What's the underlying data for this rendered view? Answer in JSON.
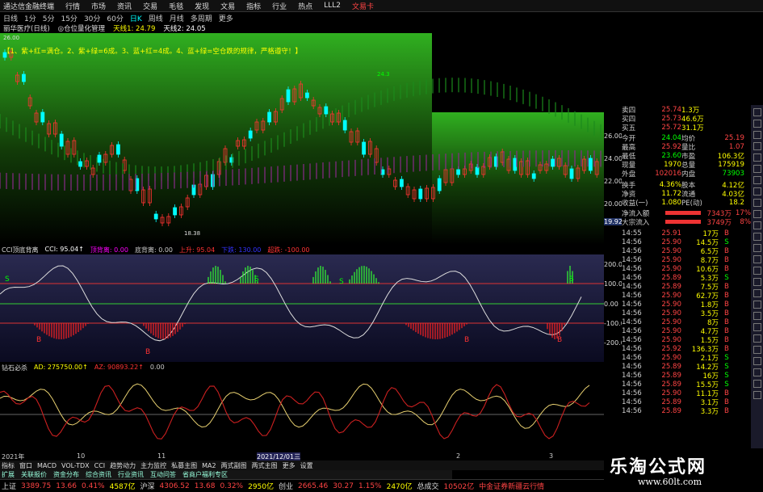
{
  "menubar": {
    "items": [
      "通达信金融终端",
      "行情",
      "市场",
      "资讯",
      "交易",
      "毛毯",
      "发现",
      "文易",
      "指标",
      "行业",
      "热点",
      "LLL2",
      "文易卡"
    ]
  },
  "periods": [
    "日线",
    "1分",
    "5分",
    "15分",
    "30分",
    "60分",
    "日K",
    "周线",
    "月线",
    "多周期",
    "更多"
  ],
  "period_selected": "日K",
  "info": {
    "stock": "丽华医疗(日线)",
    "indicator": "◎仓位量化管理",
    "line1": "天线1: 24.79",
    "line2": "天线2: 24.05"
  },
  "rule_text": "【1、紫+红=满仓。2、紫+绿=6成。3、蓝+红=4成。4、蓝+绿=空仓跌的规律，严格遵守！】",
  "main_chart": {
    "top_price": "26.00",
    "min_label": "18.38",
    "max_label": "24.3",
    "right_ticks": [
      "26.00",
      "24.00",
      "22.00",
      "20.00"
    ],
    "right_values": [
      "19.92"
    ]
  },
  "cci": {
    "title": "CCI顶底背离",
    "cci_value": "CCI: 95.04↑",
    "top_div": "顶背离: 0.00",
    "bottom_div": "底背离: 0.00",
    "up": "上升: 95.04",
    "down": "下跌: 130.00",
    "super": "超跌: -100.00",
    "ticks": [
      "200.00",
      "100.00",
      "0.00",
      "-100.00",
      "-200.00"
    ]
  },
  "ad": {
    "title": "钻石必杀",
    "ad_value": "AD: 275750.00↑",
    "az_value": "AZ: 90893.22↑",
    "zero": "0.00"
  },
  "time_axis": [
    "2021年",
    "10",
    "11",
    "2021/12/01三",
    "2",
    "3"
  ],
  "quote_panel": {
    "rows": [
      [
        "卖四",
        "25.74",
        "1.3万"
      ],
      [
        "买四",
        "25.73",
        "46.6万"
      ],
      [
        "买五",
        "25.72",
        "31.1万"
      ]
    ],
    "open_row": [
      "今开",
      "24.04",
      "均价",
      "25.19"
    ],
    "high_row": [
      "最高",
      "25.92",
      "量比",
      "1.07"
    ],
    "low_row": [
      "最低",
      "23.60",
      "市盈",
      "106.3亿"
    ],
    "vol_row": [
      "现量",
      "1970",
      "总量",
      "175919"
    ],
    "out_row": [
      "外盘",
      "102016",
      "内盘",
      "73903"
    ],
    "turn_row": [
      "换手",
      "4.36%",
      "股本",
      "4.12亿"
    ],
    "net_row": [
      "净资",
      "11.72",
      "流通",
      "4.03亿"
    ],
    "eps_row": [
      "收益(一)",
      "1.080",
      "PE(动)",
      "18.2"
    ],
    "inflow1": [
      "净流入额",
      "7343万",
      "17%"
    ],
    "inflow2": [
      "大宗流入",
      "3749万",
      "8%"
    ]
  },
  "ticks": [
    [
      "14:55",
      "25.91",
      "17万",
      "B"
    ],
    [
      "14:56",
      "25.90",
      "14.5万",
      "S"
    ],
    [
      "14:56",
      "25.90",
      "6.5万",
      "B"
    ],
    [
      "14:56",
      "25.90",
      "8.7万",
      "B"
    ],
    [
      "14:56",
      "25.90",
      "10.6万",
      "B"
    ],
    [
      "14:56",
      "25.89",
      "5.3万",
      "S"
    ],
    [
      "14:56",
      "25.89",
      "7.5万",
      "B"
    ],
    [
      "14:56",
      "25.90",
      "62.7万",
      "B"
    ],
    [
      "14:56",
      "25.90",
      "1.8万",
      "B"
    ],
    [
      "14:56",
      "25.90",
      "3.5万",
      "B"
    ],
    [
      "14:56",
      "25.90",
      "8万",
      "B"
    ],
    [
      "14:56",
      "25.90",
      "4.7万",
      "B"
    ],
    [
      "14:56",
      "25.90",
      "1.5万",
      "B"
    ],
    [
      "14:56",
      "25.92",
      "136.3万",
      "B"
    ],
    [
      "14:56",
      "25.90",
      "2.1万",
      "S"
    ],
    [
      "14:56",
      "25.89",
      "14.2万",
      "S"
    ],
    [
      "14:56",
      "25.89",
      "16万",
      "S"
    ],
    [
      "14:56",
      "25.89",
      "15.5万",
      "S"
    ],
    [
      "14:56",
      "25.90",
      "11.1万",
      "B"
    ],
    [
      "14:56",
      "25.89",
      "3.1万",
      "B"
    ],
    [
      "14:56",
      "25.89",
      "3.3万",
      "B"
    ]
  ],
  "tabs1": [
    "指标",
    "窗口",
    "MACD",
    "VOL-TDX",
    "CCI",
    "趋势动力",
    "主力监控",
    "私募主图",
    "MA2",
    "两式副图",
    "两式主图",
    "更多",
    "设置"
  ],
  "tabs2": [
    "扩展",
    "关联报价",
    "资金分布",
    "综合资讯",
    "行业资讯",
    "互动问答",
    "省商户福利专区"
  ],
  "ticker": [
    {
      "label": "上证",
      "v1": "3389.75",
      "v2": "13.66",
      "v3": "0.41%",
      "v4": "4587亿"
    },
    {
      "label": "沪深",
      "v1": "4306.52",
      "v2": "13.68",
      "v3": "0.32%",
      "v4": "2950亿"
    },
    {
      "label": "创业",
      "v1": "2665.46",
      "v2": "30.27",
      "v3": "1.15%",
      "v4": "2470亿"
    },
    {
      "label": "总成交",
      "v1": "10502亿",
      "v2": "中金证券新疆云行情",
      "v3": "",
      "v4": ""
    }
  ],
  "watermark": {
    "title": "乐淘公式网",
    "url": "www.60lt.com"
  },
  "colors": {
    "up": "#ff3333",
    "down": "#00ffff",
    "green": "#00ff00",
    "yellow": "#ffff00",
    "bg": "#000000"
  }
}
